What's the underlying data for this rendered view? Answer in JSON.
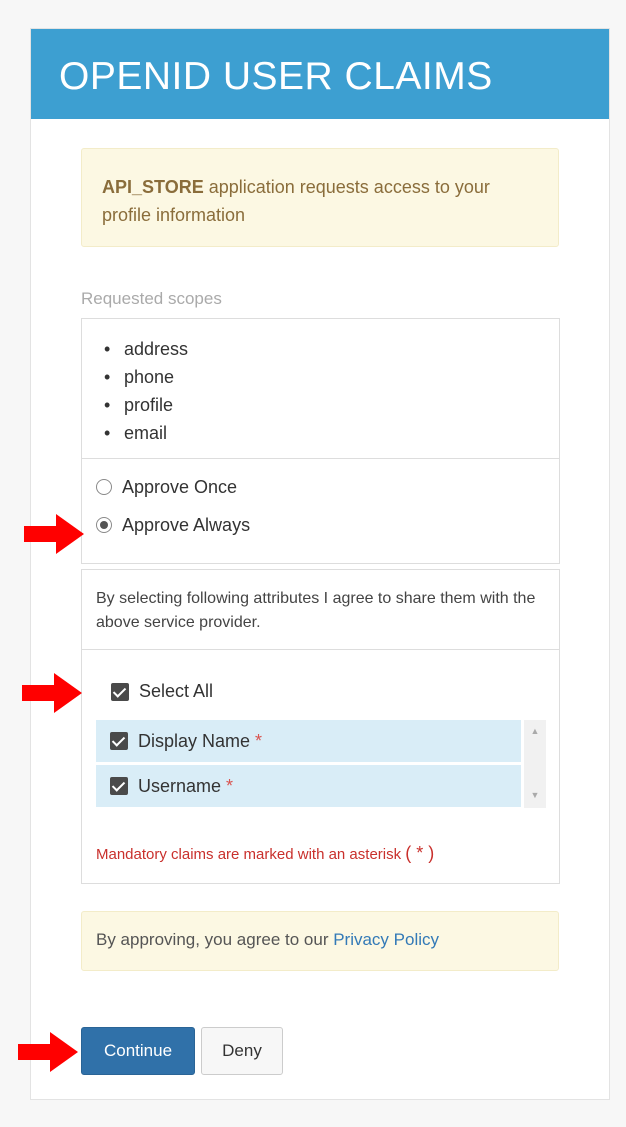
{
  "header": {
    "title": "OPENID USER CLAIMS"
  },
  "consent": {
    "app_name": "API_STORE",
    "message": " application requests access to your profile information"
  },
  "scopes": {
    "label": "Requested scopes",
    "items": [
      "address",
      "phone",
      "profile",
      "email"
    ]
  },
  "approval": {
    "options": [
      {
        "label": "Approve Once",
        "selected": false
      },
      {
        "label": "Approve Always",
        "selected": true
      }
    ]
  },
  "attributes": {
    "intro": "By selecting following attributes I agree to share them with the above service provider.",
    "select_all_label": "Select All",
    "claims": [
      {
        "label": "Display Name",
        "mandatory": "*"
      },
      {
        "label": "Username",
        "mandatory": "*"
      }
    ],
    "mandatory_note": "Mandatory claims are marked with an asterisk",
    "mandatory_symbol": "( * )"
  },
  "privacy": {
    "text": "By approving, you agree to our ",
    "link_label": "Privacy Policy"
  },
  "actions": {
    "continue_label": "Continue",
    "deny_label": "Deny"
  },
  "colors": {
    "header_bg": "#3d9fd1",
    "primary_button": "#3071a9",
    "annotation_arrow": "#ff0000",
    "claim_row_bg": "#d9edf7",
    "mandatory_red": "#c9302c"
  }
}
